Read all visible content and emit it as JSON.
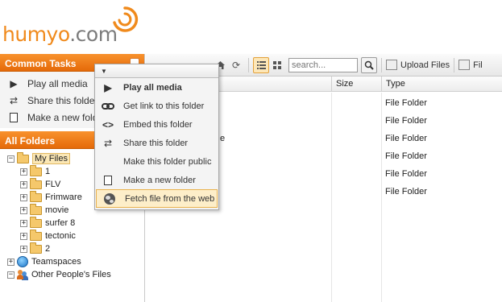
{
  "logo": {
    "brand": "humyo",
    "suffix": ".com"
  },
  "left": {
    "common_tasks_title": "Common Tasks",
    "tasks": [
      {
        "label": "Play all media",
        "icon": "play-icon"
      },
      {
        "label": "Share this folder",
        "icon": "share-icon"
      },
      {
        "label": "Make a new folder",
        "icon": "new-folder-icon"
      }
    ],
    "all_folders_title": "All Folders",
    "tree": {
      "root": "My Files",
      "children": [
        "1",
        "FLV",
        "Frimware",
        "movie",
        "surfer 8",
        "tectonic",
        "2"
      ],
      "teamspaces": "Teamspaces",
      "other": "Other People's Files"
    }
  },
  "toolbar": {
    "search_placeholder": "search...",
    "upload_label": "Upload Files",
    "extra_label": "Fil"
  },
  "grid": {
    "columns": {
      "size": "Size",
      "type": "Type"
    },
    "rows": [
      {
        "name": "",
        "type": "File Folder"
      },
      {
        "name": "",
        "type": "File Folder"
      },
      {
        "name": "e",
        "type": "File Folder"
      },
      {
        "name": "",
        "type": "File Folder"
      },
      {
        "name": "",
        "type": "File Folder"
      },
      {
        "name": "",
        "type": "File Folder"
      }
    ]
  },
  "menu": {
    "items": [
      {
        "label": "Play all media",
        "icon": "play-icon"
      },
      {
        "label": "Get link to this folder",
        "icon": "link-icon"
      },
      {
        "label": "Embed this folder",
        "icon": "embed-icon"
      },
      {
        "label": "Share this folder",
        "icon": "share-icon"
      },
      {
        "label": "Make this folder public",
        "icon": ""
      },
      {
        "label": "Make a new folder",
        "icon": "new-folder-icon"
      },
      {
        "label": "Fetch file from the web",
        "icon": "globe-icon"
      }
    ]
  },
  "colors": {
    "accent": "#f08a1c",
    "highlight": "#fdeec9"
  }
}
